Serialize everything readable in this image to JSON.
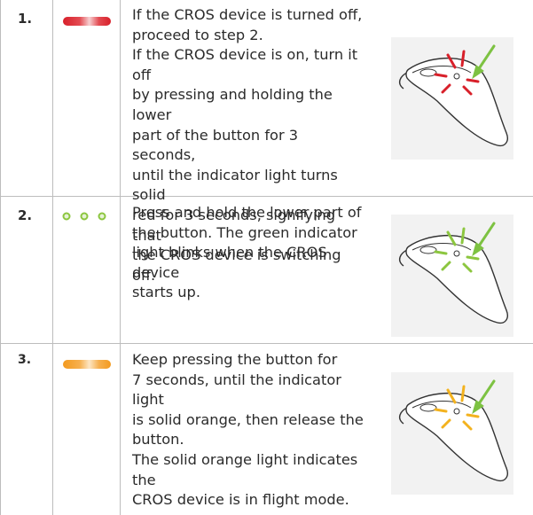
{
  "steps": [
    {
      "number": "1.",
      "indicator": "solid-red-bar",
      "text": "If the CROS device is turned off,\nproceed to step 2.\nIf the CROS device is on, turn it off\nby pressing and holding the lower\npart of the button for 3 seconds,\nuntil the indicator light turns solid\nred for 3 seconds, signifying that\nthe CROS device is switching off.",
      "light_color": "#d8202a",
      "image_icon": "cros-device-red-light-illustration"
    },
    {
      "number": "2.",
      "indicator": "blinking-green-dots",
      "text": "Press and hold the lower part of\nthe button. The green indicator\nlight blinks when the CROS device\nstarts up.",
      "light_color": "#8cc63f",
      "image_icon": "cros-device-green-light-illustration"
    },
    {
      "number": "3.",
      "indicator": "solid-orange-bar",
      "text": "Keep pressing the button  for\n7 seconds, until the indicator light\nis solid orange, then release the\nbutton.\nThe solid orange light indicates the\nCROS device is in flight mode.",
      "light_color": "#f39a1e",
      "image_icon": "cros-device-orange-light-illustration"
    }
  ],
  "colors": {
    "rule": "#bdbdbd",
    "arrow": "#7dc242",
    "image_bg": "#f2f2f2"
  }
}
